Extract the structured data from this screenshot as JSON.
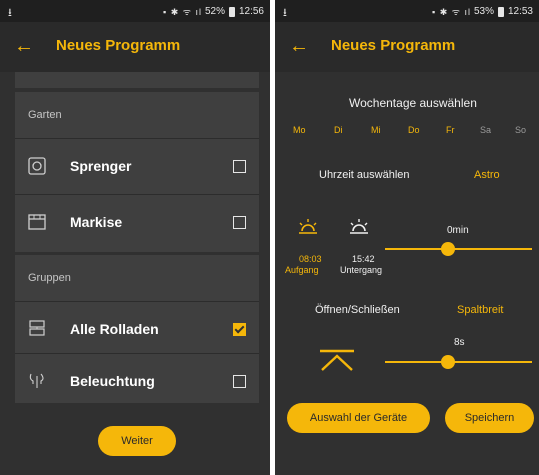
{
  "left": {
    "status": {
      "download": "⭳",
      "icons": "▪ ✱ ᯤ ıl",
      "battery_pct": "52%",
      "time": "12:56"
    },
    "appbar": {
      "title": "Neues Programm"
    },
    "sections": [
      {
        "header": "Garten",
        "items": [
          {
            "label": "Sprenger",
            "icon": "sprinkler-icon",
            "checked": false
          },
          {
            "label": "Markise",
            "icon": "awning-icon",
            "checked": false
          }
        ]
      },
      {
        "header": "Gruppen",
        "items": [
          {
            "label": "Alle Rolladen",
            "icon": "shutters-icon",
            "checked": true
          },
          {
            "label": "Beleuchtung",
            "icon": "lights-icon",
            "checked": false
          }
        ]
      }
    ],
    "next_label": "Weiter"
  },
  "right": {
    "status": {
      "download": "⭳",
      "icons": "▪ ✱ ᯤ ıl",
      "battery_pct": "53%",
      "time": "12:53"
    },
    "appbar": {
      "title": "Neues Programm"
    },
    "weekdays_title": "Wochentage auswählen",
    "days": [
      {
        "label": "Mo",
        "active": true
      },
      {
        "label": "Di",
        "active": true
      },
      {
        "label": "Mi",
        "active": true
      },
      {
        "label": "Do",
        "active": true
      },
      {
        "label": "Fr",
        "active": true
      },
      {
        "label": "Sa",
        "active": false
      },
      {
        "label": "So",
        "active": false
      }
    ],
    "time_title": "Uhrzeit auswählen",
    "astro_label": "Astro",
    "sunrise": {
      "time": "08:03",
      "label": "Aufgang"
    },
    "sunset": {
      "time": "15:42",
      "label": "Untergang"
    },
    "offset_value": "0min",
    "offset_slider_fraction": 0.43,
    "open_close_title": "Öffnen/Schließen",
    "gap_label": "Spaltbreit",
    "gap_value": "8s",
    "gap_slider_fraction": 0.43,
    "select_devices_label": "Auswahl der Geräte",
    "save_label": "Speichern"
  },
  "colors": {
    "accent": "#f5b70a",
    "background": "#303030",
    "card": "#3f3f3f"
  }
}
